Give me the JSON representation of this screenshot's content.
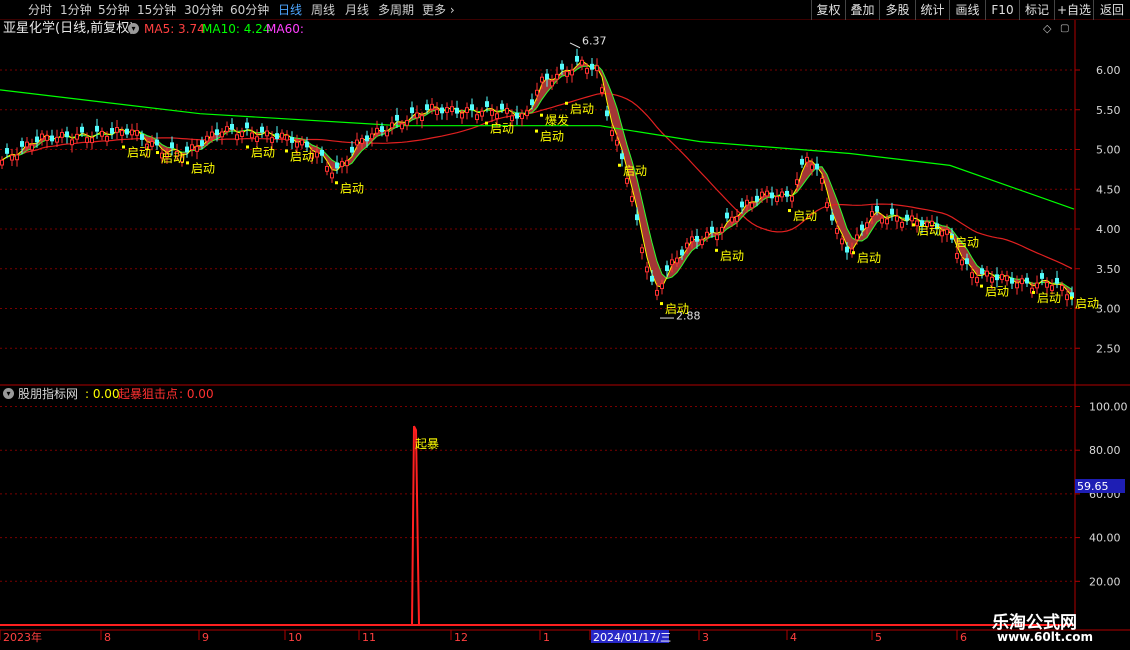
{
  "toolbar": {
    "timeframes": [
      {
        "label": "分时",
        "active": false
      },
      {
        "label": "1分钟",
        "active": false
      },
      {
        "label": "5分钟",
        "active": false
      },
      {
        "label": "15分钟",
        "active": false
      },
      {
        "label": "30分钟",
        "active": false
      },
      {
        "label": "60分钟",
        "active": false
      },
      {
        "label": "日线",
        "active": true
      },
      {
        "label": "周线",
        "active": false
      },
      {
        "label": "月线",
        "active": false
      },
      {
        "label": "多周期",
        "active": false
      },
      {
        "label": "更多",
        "active": false
      }
    ],
    "right_buttons": [
      "复权",
      "叠加",
      "多股",
      "统计",
      "画线",
      "F10",
      "标记",
      "+自选",
      "返回"
    ]
  },
  "title": {
    "stock": "亚星化学(日线,前复权)",
    "ma5": "MA5: 3.74",
    "ma10": "MA10: 4.24",
    "ma60": "MA60:"
  },
  "indicator_title": {
    "name": "股朋指标网",
    "name_value": ": 0.00",
    "series": "起暴狙击点",
    "series_value": ": 0.00"
  },
  "cursor_value": "59.65",
  "watermark": {
    "line1": "乐淘公式网",
    "line2": "www.60lt.com"
  },
  "colors": {
    "up": "#ff3232",
    "down": "#54fcfc",
    "ma5": "#ffffff",
    "ma10": "#ffff00",
    "ma60": "#00ff00",
    "red_line": "#e02020",
    "signal": "#ffff00",
    "ribbon": "#c04040",
    "grid": "#7a0000",
    "axis": "#b00000"
  },
  "chart_data": [
    {
      "type": "candlestick",
      "y_ticks": [
        2.5,
        3.0,
        3.5,
        4.0,
        4.5,
        5.0,
        5.5,
        6.0
      ],
      "ylim": [
        2.2,
        6.6
      ],
      "x_labels": [
        "2023年",
        "8",
        "9",
        "10",
        "11",
        "12",
        "1",
        "2024/01/17/三",
        "3",
        "4",
        "5",
        "6"
      ],
      "annotations": {
        "high": "6.37",
        "low": "2.88"
      },
      "signals": [
        {
          "label": "启动",
          "x": 122,
          "y": 4.95
        },
        {
          "label": "启动",
          "x": 156,
          "y": 4.88
        },
        {
          "label": "启动",
          "x": 186,
          "y": 4.75
        },
        {
          "label": "启动",
          "x": 246,
          "y": 4.95
        },
        {
          "label": "启动",
          "x": 285,
          "y": 4.9
        },
        {
          "label": "启动",
          "x": 335,
          "y": 4.5
        },
        {
          "label": "启动",
          "x": 485,
          "y": 5.25
        },
        {
          "label": "爆发",
          "x": 540,
          "y": 5.35
        },
        {
          "label": "启动",
          "x": 535,
          "y": 5.15
        },
        {
          "label": "启动",
          "x": 565,
          "y": 5.5
        },
        {
          "label": "启动",
          "x": 618,
          "y": 4.72
        },
        {
          "label": "启动",
          "x": 660,
          "y": 2.98
        },
        {
          "label": "启动",
          "x": 715,
          "y": 3.65
        },
        {
          "label": "启动",
          "x": 788,
          "y": 4.15
        },
        {
          "label": "启动",
          "x": 852,
          "y": 3.62
        },
        {
          "label": "启动",
          "x": 912,
          "y": 3.97
        },
        {
          "label": "启动",
          "x": 950,
          "y": 3.82
        },
        {
          "label": "启动",
          "x": 980,
          "y": 3.2
        },
        {
          "label": "启动",
          "x": 1032,
          "y": 3.12
        },
        {
          "label": "启动",
          "x": 1070,
          "y": 3.05
        }
      ]
    },
    {
      "type": "line",
      "series": [
        {
          "name": "起暴狙击点",
          "spike_x": 415,
          "peak": 91,
          "label": "起暴"
        }
      ],
      "y_ticks": [
        20.0,
        40.0,
        60.0,
        80.0,
        100.0
      ],
      "ylim": [
        0,
        105
      ]
    }
  ]
}
